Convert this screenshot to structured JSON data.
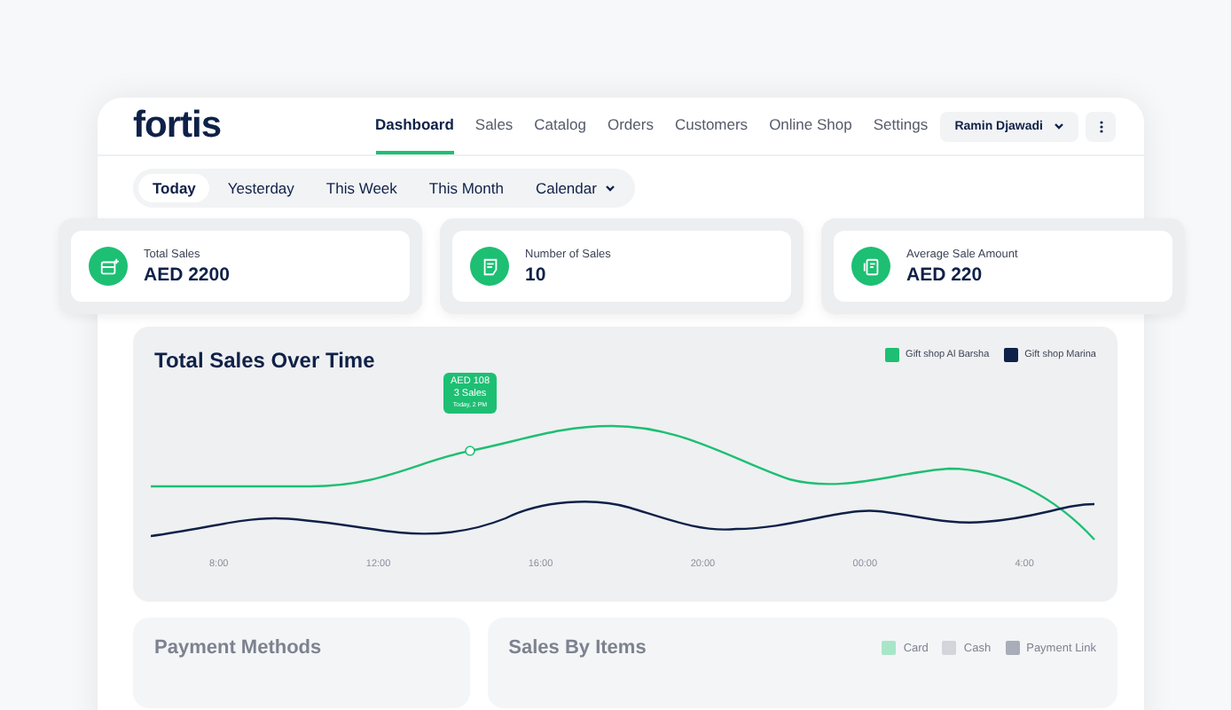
{
  "brand": "fortis",
  "nav": [
    {
      "label": "Dashboard",
      "selected": true
    },
    {
      "label": "Sales",
      "selected": false
    },
    {
      "label": "Catalog",
      "selected": false
    },
    {
      "label": "Orders",
      "selected": false
    },
    {
      "label": "Customers",
      "selected": false
    },
    {
      "label": "Online Shop",
      "selected": false
    },
    {
      "label": "Settings",
      "selected": false
    }
  ],
  "user": {
    "name": "Ramin Djawadi"
  },
  "range_filters": [
    {
      "label": "Today",
      "selected": true,
      "kind": "plain"
    },
    {
      "label": "Yesterday",
      "selected": false,
      "kind": "plain"
    },
    {
      "label": "This Week",
      "selected": false,
      "kind": "plain"
    },
    {
      "label": "This Month",
      "selected": false,
      "kind": "plain"
    },
    {
      "label": "Calendar",
      "selected": false,
      "kind": "dropdown"
    }
  ],
  "stats": [
    {
      "label": "Total Sales",
      "value": "AED 2200",
      "kind": "register"
    },
    {
      "label": "Number of Sales",
      "value": "10",
      "kind": "receipt"
    },
    {
      "label": "Average Sale Amount",
      "value": "AED 220",
      "kind": "document"
    }
  ],
  "sales_chart": {
    "title": "Total Sales Over Time",
    "legend": [
      {
        "label": "Gift shop Al Barsha",
        "color": "#1dbf73"
      },
      {
        "label": "Gift shop Marina",
        "color": "#0f2148"
      }
    ],
    "tooltip": {
      "amount": "AED 108",
      "count": "3 Sales",
      "time": "Today, 2 PM"
    },
    "x_labels": [
      "8:00",
      "12:00",
      "16:00",
      "20:00",
      "00:00",
      "4:00"
    ]
  },
  "payment_methods": {
    "title": "Payment Methods"
  },
  "sales_by_items": {
    "title": "Sales By Items",
    "legend": [
      {
        "label": "Card",
        "color": "#a8e6c8"
      },
      {
        "label": "Cash",
        "color": "#d3d5da"
      },
      {
        "label": "Payment Link",
        "color": "#a9adb9"
      }
    ]
  }
}
